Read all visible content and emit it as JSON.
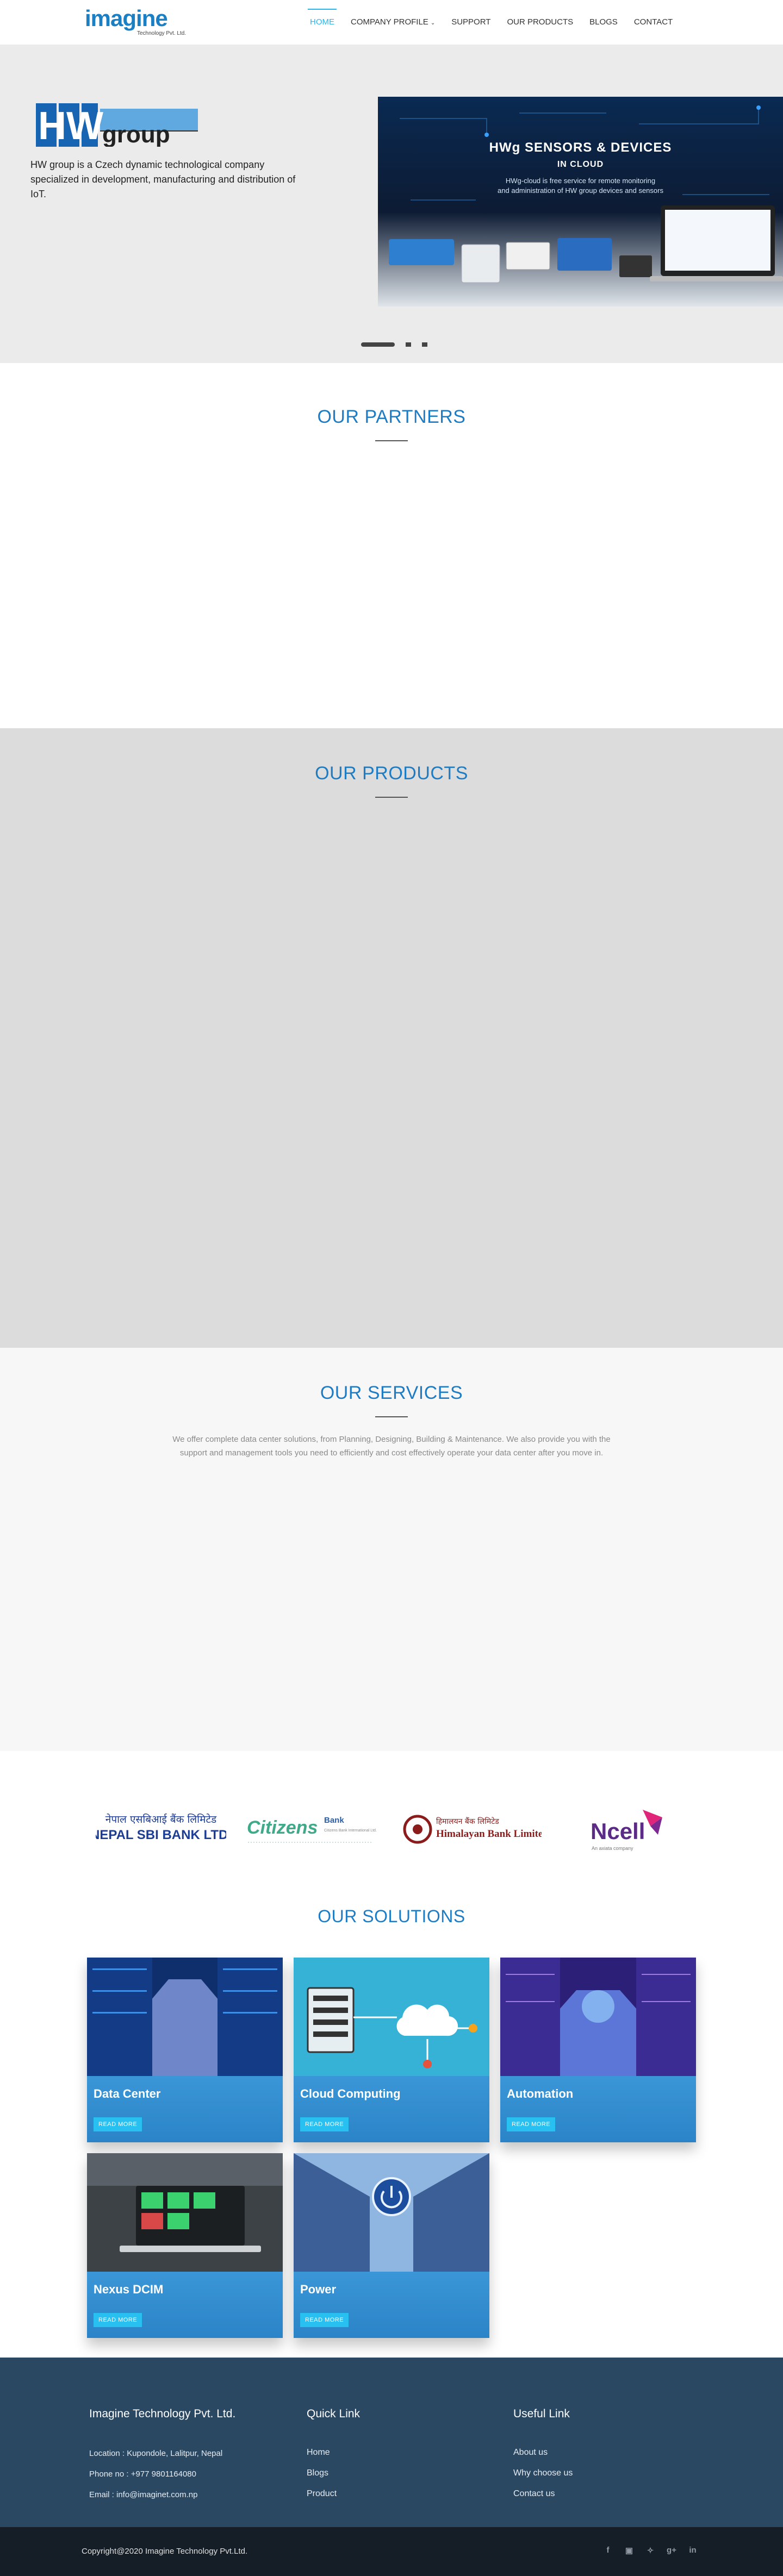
{
  "header": {
    "logo_text": "imagine",
    "logo_sub": "Technology Pvt. Ltd.",
    "nav": [
      {
        "label": "HOME",
        "active": true
      },
      {
        "label": "COMPANY PROFILE",
        "caret": true
      },
      {
        "label": "SUPPORT"
      },
      {
        "label": "OUR PRODUCTS"
      },
      {
        "label": "BLOGS"
      },
      {
        "label": "CONTACT"
      }
    ]
  },
  "hero": {
    "brand_hw": "HW",
    "brand_group": "group",
    "description": "HW group is a Czech dynamic technological company specialized in development, manufacturing and distribution of IoT.",
    "panel_title": "HWg SENSORS & DEVICES",
    "panel_subtitle": "IN CLOUD",
    "panel_text": "HWg-cloud is free service for remote monitoring\nand administration of HW group devices and sensors"
  },
  "partners": {
    "title": "OUR PARTNERS"
  },
  "products": {
    "title": "OUR PRODUCTS"
  },
  "services": {
    "title": "OUR SERVICES",
    "text": "We offer complete data center solutions, from Planning, Designing, Building & Maintenance. We also provide you with the support and management tools you need to efficiently and cost effectively operate your data center after you move in."
  },
  "clients": {
    "nsbl_nepali": "नेपाल एसबिआई बैंक लिमिटेड",
    "nsbl_english": "NEPAL SBI BANK LTD.",
    "citizens": "Citizens",
    "citizens_bank": "Bank",
    "citizens_tag": "Citizens Bank International Ltd.",
    "himalayan_nepali": "हिमालयन बैंक लिमिटेड",
    "himalayan": "Himalayan Bank Limited",
    "ncell": "Ncell",
    "ncell_sub": "An axiata company"
  },
  "solutions": {
    "title": "OUR SOLUTIONS",
    "read_more": "READ MORE",
    "cards": [
      {
        "title": "Data Center"
      },
      {
        "title": "Cloud Computing"
      },
      {
        "title": "Automation"
      },
      {
        "title": "Nexus DCIM"
      },
      {
        "title": "Power"
      }
    ]
  },
  "footer": {
    "company": "Imagine Technology Pvt. Ltd.",
    "location": "Location : Kupondole, Lalitpur, Nepal",
    "phone": "Phone no : +977 9801164080",
    "email": "Email : info@imaginet.com.np",
    "quick_title": "Quick Link",
    "quick_links": [
      "Home",
      "Blogs",
      "Product"
    ],
    "useful_title": "Useful Link",
    "useful_links": [
      "About us",
      "Why choose us",
      "Contact us"
    ],
    "copyright": "Copyright@2020 Imagine Technology Pvt.Ltd.",
    "social_icons": [
      "facebook-icon",
      "instagram-icon",
      "twitter-icon",
      "google-plus-icon",
      "linkedin-icon"
    ]
  },
  "colors": {
    "brand_blue": "#1d7cc3",
    "accent_cyan": "#2cb5e8",
    "card_blue": "#2f8fd2",
    "footer_bg": "#2b4863"
  }
}
